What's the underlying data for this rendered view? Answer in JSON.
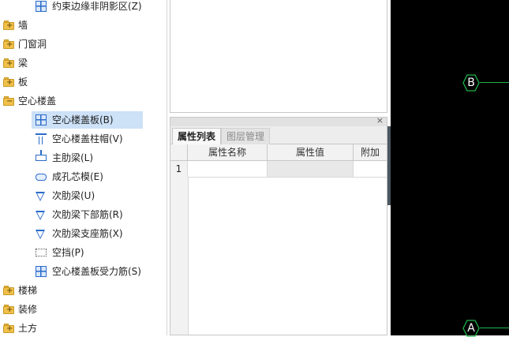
{
  "tree": {
    "items": [
      {
        "type": "child",
        "label": "约束边缘非阴影区(Z)",
        "icon": "constraint-icon"
      },
      {
        "type": "folder",
        "label": "墙",
        "icon": "folder-icon"
      },
      {
        "type": "folder",
        "label": "门窗洞",
        "icon": "folder-icon"
      },
      {
        "type": "folder",
        "label": "梁",
        "icon": "folder-icon"
      },
      {
        "type": "folder",
        "label": "板",
        "icon": "folder-icon"
      },
      {
        "type": "folder-open",
        "label": "空心楼盖",
        "icon": "folder-minus-icon"
      },
      {
        "type": "child",
        "label": "空心楼盖板(B)",
        "icon": "hollow-slab-icon",
        "selected": true
      },
      {
        "type": "child",
        "label": "空心楼盖柱帽(V)",
        "icon": "column-cap-icon"
      },
      {
        "type": "child",
        "label": "主肋梁(L)",
        "icon": "main-rib-icon"
      },
      {
        "type": "child",
        "label": "成孔芯模(E)",
        "icon": "core-mold-icon"
      },
      {
        "type": "child",
        "label": "次肋梁(U)",
        "icon": "secondary-rib-icon"
      },
      {
        "type": "child",
        "label": "次肋梁下部筋(R)",
        "icon": "rib-bottom-bar-icon"
      },
      {
        "type": "child",
        "label": "次肋梁支座筋(X)",
        "icon": "rib-support-bar-icon"
      },
      {
        "type": "child",
        "label": "空挡(P)",
        "icon": "void-icon"
      },
      {
        "type": "child",
        "label": "空心楼盖板受力筋(S)",
        "icon": "slab-rebar-icon"
      },
      {
        "type": "folder",
        "label": "楼梯",
        "icon": "folder-icon"
      },
      {
        "type": "folder",
        "label": "装修",
        "icon": "folder-icon"
      },
      {
        "type": "folder",
        "label": "土方",
        "icon": "folder-icon"
      }
    ]
  },
  "panel": {
    "close": "×",
    "tabs": [
      "属性列表",
      "图层管理"
    ],
    "headers": [
      "属性名称",
      "属性值",
      "附加"
    ],
    "rows": [
      {
        "num": "1",
        "name": "",
        "value": "",
        "add": ""
      }
    ]
  },
  "canvas": {
    "axes": [
      "B",
      "A"
    ],
    "axis_color": "#1fb34a"
  }
}
